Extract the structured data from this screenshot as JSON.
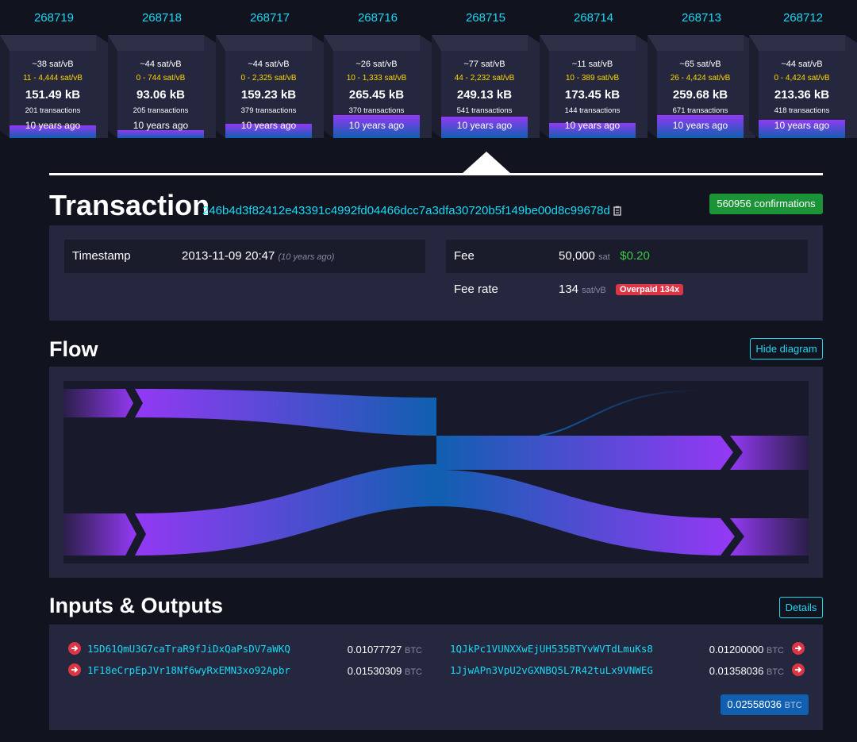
{
  "blocks": [
    {
      "height": "268719",
      "fee": "~38 sat/vB",
      "range": "11 - 4,444 sat/vB",
      "size": "151.49 kB",
      "txs": "201 transactions",
      "ago": "10 years ago",
      "fill_fraction": 0.15
    },
    {
      "height": "268718",
      "fee": "~44 sat/vB",
      "range": "0 - 744 sat/vB",
      "size": "93.06 kB",
      "txs": "205 transactions",
      "ago": "10 years ago",
      "fill_fraction": 0.09
    },
    {
      "height": "268717",
      "fee": "~44 sat/vB",
      "range": "0 - 2,325 sat/vB",
      "size": "159.23 kB",
      "txs": "379 transactions",
      "ago": "10 years ago",
      "fill_fraction": 0.16
    },
    {
      "height": "268716",
      "fee": "~26 sat/vB",
      "range": "10 - 1,333 sat/vB",
      "size": "265.45 kB",
      "txs": "370 transactions",
      "ago": "10 years ago",
      "fill_fraction": 0.26
    },
    {
      "height": "268715",
      "fee": "~77 sat/vB",
      "range": "44 - 2,232 sat/vB",
      "size": "249.13 kB",
      "txs": "541 transactions",
      "ago": "10 years ago",
      "fill_fraction": 0.25
    },
    {
      "height": "268714",
      "fee": "~11 sat/vB",
      "range": "10 - 389 sat/vB",
      "size": "173.45 kB",
      "txs": "144 transactions",
      "ago": "10 years ago",
      "fill_fraction": 0.17
    },
    {
      "height": "268713",
      "fee": "~65 sat/vB",
      "range": "26 - 4,424 sat/vB",
      "size": "259.68 kB",
      "txs": "671 transactions",
      "ago": "10 years ago",
      "fill_fraction": 0.26
    },
    {
      "height": "268712",
      "fee": "~44 sat/vB",
      "range": "0 - 4,424 sat/vB",
      "size": "213.36 kB",
      "txs": "418 transactions",
      "ago": "10 years ago",
      "fill_fraction": 0.21
    }
  ],
  "transaction": {
    "title": "Transaction",
    "txid": "246b4d3f82412e43391c4992fd04466dcc7a3dfa30720b5f149be00d8c99678d",
    "confirmations": "560956 confirmations",
    "timestamp_label": "Timestamp",
    "timestamp_value": "2013-11-09 20:47",
    "timestamp_ago": "(10 years ago)",
    "fee_label": "Fee",
    "fee_value": "50,000",
    "fee_unit": "sat",
    "fee_usd": "$0.20",
    "feerate_label": "Fee rate",
    "feerate_value": "134",
    "feerate_unit": "sat/vB",
    "overpaid": "Overpaid 134x"
  },
  "flow": {
    "title": "Flow",
    "hide_label": "Hide diagram"
  },
  "io": {
    "title": "Inputs & Outputs",
    "details_label": "Details",
    "inputs": [
      {
        "address": "15D61QmU3G7caTraR9fJiDxQaPsDV7aWKQ",
        "amount": "0.01077727",
        "unit": "BTC"
      },
      {
        "address": "1F18eCrpEpJVr18Nf6wyRxEMN3xo92Apbr",
        "amount": "0.01530309",
        "unit": "BTC"
      }
    ],
    "outputs": [
      {
        "address": "1QJkPc1VUNXXwEjUH535BTYvWVTdLmuKs8",
        "amount": "0.01200000",
        "unit": "BTC"
      },
      {
        "address": "1JjwAPn3VpU2vGXNBQ5L7R42tuLx9VNWEG",
        "amount": "0.01358036",
        "unit": "BTC"
      }
    ],
    "total_amount": "0.02558036",
    "total_unit": "BTC"
  },
  "colors": {
    "accent": "#1bd8f4",
    "fee_range": "#ffd800",
    "confirm": "#1a9436",
    "overpaid": "#dc3545",
    "flow_purple": "#9339f4",
    "flow_blue": "#105fb0",
    "usd": "#3bcc49"
  },
  "icons": {
    "copy": "copy-icon",
    "input_arrow": "arrow-right-circle-icon",
    "output_arrow": "arrow-right-circle-icon"
  }
}
